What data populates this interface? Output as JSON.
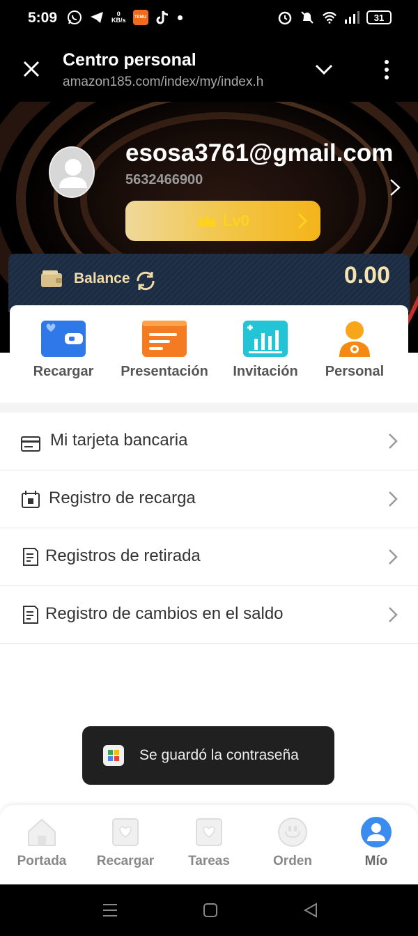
{
  "status_bar": {
    "time": "5:09",
    "net_speed_value": "0",
    "net_speed_unit": "KB/s",
    "temu_label": "TEMU",
    "battery": "31"
  },
  "browser": {
    "title": "Centro personal",
    "url": "amazon185.com/index/my/index.h"
  },
  "profile": {
    "email": "esosa3761@gmail.com",
    "id": "5632466900",
    "level": "Lv0"
  },
  "balance": {
    "label": "Balance",
    "value": "0.00"
  },
  "actions": [
    {
      "label": "Recargar",
      "icon": "wallet-card-icon"
    },
    {
      "label": "Presentación",
      "icon": "document-icon"
    },
    {
      "label": "Invitación",
      "icon": "chart-icon"
    },
    {
      "label": "Personal",
      "icon": "person-gear-icon"
    }
  ],
  "menu": [
    {
      "label": "Mi tarjeta bancaria",
      "icon": "bank-card-icon"
    },
    {
      "label": "Registro de recarga",
      "icon": "recharge-record-icon"
    },
    {
      "label": "Registros de retirada",
      "icon": "withdraw-record-icon"
    },
    {
      "label": "Registro de cambios en el saldo",
      "icon": "balance-record-icon"
    }
  ],
  "toast": {
    "text": "Se guardó la contraseña"
  },
  "bottom_nav": [
    {
      "label": "Portada",
      "icon": "home-icon",
      "active": false
    },
    {
      "label": "Recargar",
      "icon": "recharge-icon",
      "active": false
    },
    {
      "label": "Tareas",
      "icon": "tasks-icon",
      "active": false
    },
    {
      "label": "Orden",
      "icon": "order-icon",
      "active": false
    },
    {
      "label": "Mío",
      "icon": "profile-icon",
      "active": true
    }
  ],
  "colors": {
    "accent_gold": "#f4b41a",
    "active_blue": "#3b8cf0",
    "dark_bg": "#000000",
    "balance_strip": "#1c2b40"
  }
}
